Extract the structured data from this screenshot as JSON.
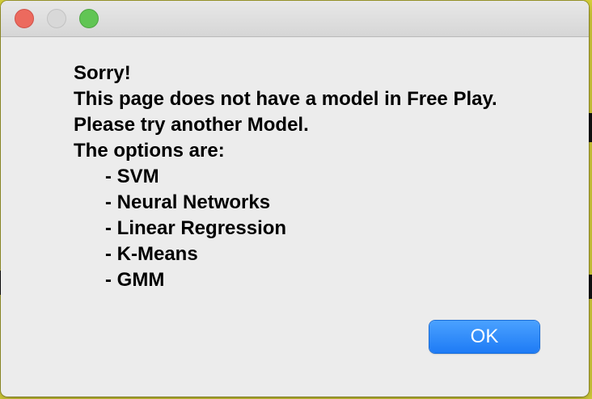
{
  "dialog": {
    "title": "",
    "message_lines": [
      "Sorry!",
      "This page does not have a model in Free Play.",
      "Please try another Model.",
      "The options are:"
    ],
    "options": [
      "- SVM",
      "- Neural Networks",
      "- Linear Regression",
      "- K-Means",
      "- GMM"
    ],
    "ok_label": "OK"
  },
  "colors": {
    "close": "#ec6a5e",
    "minimize": "#d8d8d8",
    "zoom": "#61c554",
    "button_blue": "#1e7bf5",
    "dialog_bg": "#ececec"
  }
}
